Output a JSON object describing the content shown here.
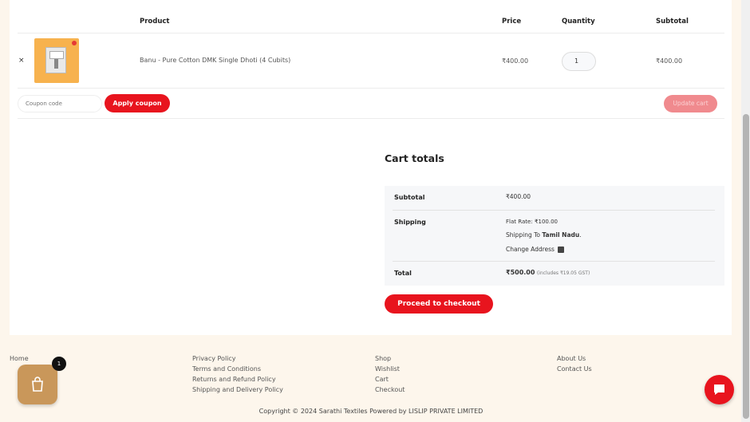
{
  "table": {
    "headers": {
      "product": "Product",
      "price": "Price",
      "quantity": "Quantity",
      "subtotal": "Subtotal"
    },
    "item": {
      "remove": "×",
      "name": "Banu - Pure Cotton DMK Single Dhoti (4 Cubits)",
      "price": "₹400.00",
      "quantity": "1",
      "subtotal": "₹400.00"
    }
  },
  "coupon": {
    "placeholder": "Coupon code",
    "apply_label": "Apply coupon",
    "update_label": "Update cart"
  },
  "totals": {
    "title": "Cart totals",
    "subtotal_label": "Subtotal",
    "subtotal_value": "₹400.00",
    "shipping_label": "Shipping",
    "flat_rate_label": "Flat Rate:",
    "flat_rate_value": "₹100.00",
    "shipping_to_prefix": "Shipping To",
    "shipping_to_state": "Tamil Nadu",
    "shipping_to_suffix": ".",
    "change_address": "Change Address",
    "total_label": "Total",
    "total_value": "₹500.00",
    "total_note": "(includes ₹19.05 GST)",
    "checkout_label": "Proceed to checkout"
  },
  "footer": {
    "col1": [
      "Home"
    ],
    "col2": [
      "Privacy Policy",
      "Terms and Conditions",
      "Returns and Refund Policy",
      "Shipping and Delivery Policy"
    ],
    "col3": [
      "Shop",
      "Wishlist",
      "Cart",
      "Checkout"
    ],
    "col4": [
      "About Us",
      "Contact Us"
    ],
    "copyright": "Copyright © 2024 Sarathi Textiles Powered by LISLIP PRIVATE LIMITED"
  },
  "cart_badge": "1",
  "colors": {
    "accent": "#e8141e",
    "cart_fab": "#c9975a",
    "page_bg": "#fdf6ec"
  }
}
